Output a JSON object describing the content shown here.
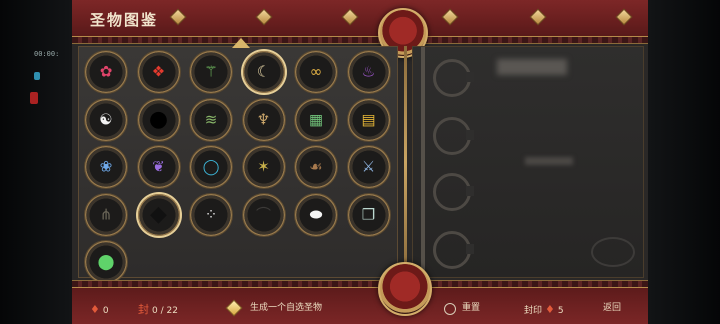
{
  "title": "圣物图鉴",
  "hud": {
    "clock": "00:00:"
  },
  "relics": [
    {
      "name": "rose-relic-icon",
      "glyph": "✿",
      "color": "#e0446a"
    },
    {
      "name": "red-crystal-relic-icon",
      "glyph": "❖",
      "color": "#e23a2e"
    },
    {
      "name": "green-staff-relic-icon",
      "glyph": "⚚",
      "color": "#7dd36a"
    },
    {
      "name": "horn-relic-icon",
      "glyph": "☾",
      "color": "#e8d7a8"
    },
    {
      "name": "gold-chain-relic-icon",
      "glyph": "∞",
      "color": "#e6b547"
    },
    {
      "name": "purple-flame-relic-icon",
      "glyph": "♨",
      "color": "#a65ad8"
    },
    {
      "name": "yin-yang-relic-icon",
      "glyph": "☯",
      "color": "#f2f2f2"
    },
    {
      "name": "void-relic-icon",
      "glyph": "●",
      "color": "#000000"
    },
    {
      "name": "bamboo-scroll-relic-icon",
      "glyph": "≋",
      "color": "#8ab86a"
    },
    {
      "name": "gourd-relic-icon",
      "glyph": "♆",
      "color": "#c9a56a"
    },
    {
      "name": "jade-tablet-relic-icon",
      "glyph": "▦",
      "color": "#6fbf78"
    },
    {
      "name": "golden-talisman-relic-icon",
      "glyph": "▤",
      "color": "#e4b637"
    },
    {
      "name": "blue-flower-relic-icon",
      "glyph": "❀",
      "color": "#6ea8e8"
    },
    {
      "name": "violet-feather-relic-icon",
      "glyph": "❦",
      "color": "#9b6ee0"
    },
    {
      "name": "sapphire-ring-relic-icon",
      "glyph": "◯",
      "color": "#3db7d9"
    },
    {
      "name": "crystal-cluster-relic-icon",
      "glyph": "✶",
      "color": "#c7b04a"
    },
    {
      "name": "wooden-bow-relic-icon",
      "glyph": "☙",
      "color": "#a87a4e"
    },
    {
      "name": "silver-gun-relic-icon",
      "glyph": "⚔",
      "color": "#8fb4e0"
    },
    {
      "name": "iron-claw-relic-icon",
      "glyph": "⋔",
      "color": "#6b6658"
    },
    {
      "name": "shadow-relic-icon",
      "glyph": "◆",
      "color": "#111111"
    },
    {
      "name": "pearl-string-relic-icon",
      "glyph": "⁘",
      "color": "#d8d8d8"
    },
    {
      "name": "dark-wing-relic-icon",
      "glyph": "⌒",
      "color": "#3c3a38"
    },
    {
      "name": "white-stone-relic-icon",
      "glyph": "⬬",
      "color": "#f4f4f4"
    },
    {
      "name": "silk-cloth-relic-icon",
      "glyph": "❒",
      "color": "#bcd8d0"
    },
    {
      "name": "green-orb-relic-icon",
      "glyph": "⬤",
      "color": "#5fd36a"
    }
  ],
  "bottom": {
    "souls": "0",
    "seal_count": "0 / 22",
    "generate_label": "生成一个自选圣物",
    "reset_label": "重置",
    "seal_label": "封印",
    "seal_value": "5",
    "back_label": "返回"
  },
  "colors": {
    "frame_red": "#6d1f1f",
    "gold_trim": "#b58b4a",
    "panel_dark": "#2a2827",
    "text_light": "#ecdcc0"
  }
}
